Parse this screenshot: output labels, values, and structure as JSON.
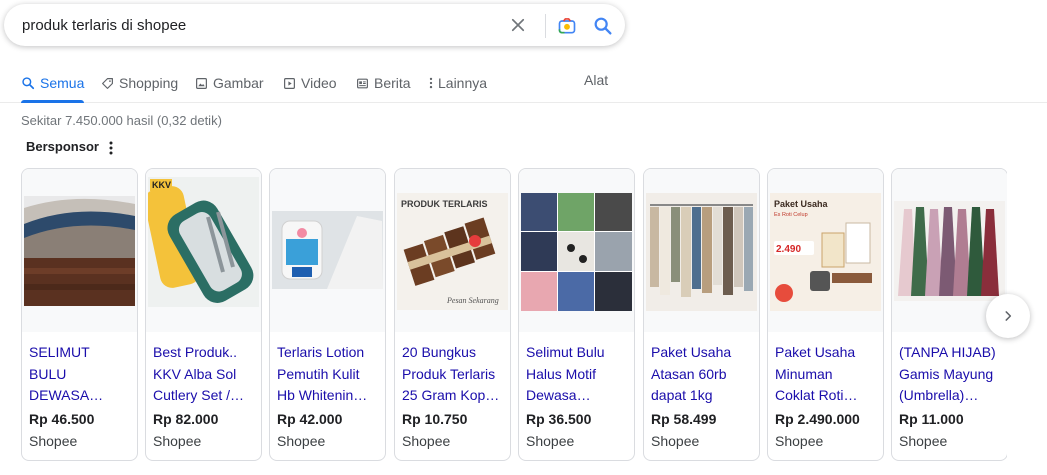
{
  "search": {
    "query": "produk terlaris di shopee"
  },
  "tabs": [
    {
      "label": "Semua",
      "icon": "search-icon"
    },
    {
      "label": "Shopping",
      "icon": "tag-icon"
    },
    {
      "label": "Gambar",
      "icon": "image-icon"
    },
    {
      "label": "Video",
      "icon": "play-icon"
    },
    {
      "label": "Berita",
      "icon": "news-icon"
    },
    {
      "label": "Lainnya",
      "icon": "more-vert-icon"
    }
  ],
  "tools_label": "Alat",
  "result_stats": "Sekitar 7.450.000 hasil (0,32 detik)",
  "sponsored_label": "Bersponsor",
  "colors": {
    "link": "#1a0dab",
    "accent": "#1a73e8"
  },
  "products": [
    {
      "title": "SELIMUT BULU DEWASA…",
      "price": "Rp 46.500",
      "seller": "Shopee"
    },
    {
      "title": "Best Produk.. KKV Alba Sol Cutlery Set /…",
      "price": "Rp 82.000",
      "seller": "Shopee",
      "image_text": "KKV"
    },
    {
      "title": "Terlaris Lotion Pemutih Kulit Hb Whitenin…",
      "price": "Rp 42.000",
      "seller": "Shopee"
    },
    {
      "title": "20 Bungkus Produk Terlaris 25 Gram Kop…",
      "price": "Rp 10.750",
      "seller": "Shopee",
      "image_text": "PRODUK TERLARIS",
      "image_subtext": "Pesan Sekarang"
    },
    {
      "title": "Selimut Bulu Halus Motif Dewasa…",
      "price": "Rp 36.500",
      "seller": "Shopee"
    },
    {
      "title": "Paket Usaha Atasan 60rb dapat 1kg",
      "price": "Rp 58.499",
      "seller": "Shopee"
    },
    {
      "title": "Paket Usaha Minuman Coklat Roti…",
      "price": "Rp 2.490.000",
      "seller": "Shopee",
      "image_text": "Paket Usaha",
      "image_subtext": "Es Roti Celup",
      "image_price": "2.490"
    },
    {
      "title": "(TANPA HIJAB) Gamis Mayung (Umbrella)…",
      "price": "Rp 11.000",
      "seller": "Shopee"
    }
  ]
}
